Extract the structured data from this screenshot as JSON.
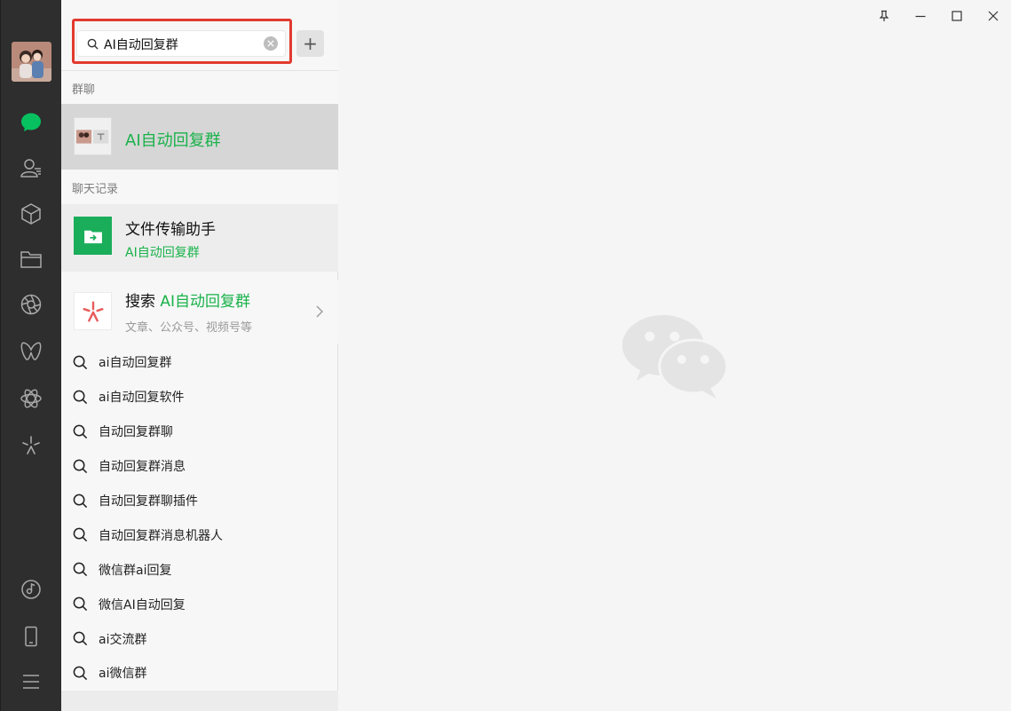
{
  "window": {
    "pin_icon": "pin-icon",
    "minimize_icon": "minimize-icon",
    "maximize_icon": "maximize-icon",
    "close_icon": "close-icon"
  },
  "navbar": {
    "avatar": "user-avatar",
    "items": [
      {
        "name": "chat",
        "icon": "chat-bubble-icon",
        "active": true
      },
      {
        "name": "contacts",
        "icon": "contacts-icon",
        "active": false
      },
      {
        "name": "favorites",
        "icon": "cube-icon",
        "active": false
      },
      {
        "name": "files",
        "icon": "folder-icon",
        "active": false
      },
      {
        "name": "moments",
        "icon": "aperture-icon",
        "active": false
      },
      {
        "name": "channels",
        "icon": "butterfly-icon",
        "active": false
      },
      {
        "name": "search",
        "icon": "atom-icon",
        "active": false
      },
      {
        "name": "mini-programs",
        "icon": "sparkle-icon",
        "active": false
      }
    ],
    "bottom_items": [
      {
        "name": "music",
        "icon": "music-disc-icon"
      },
      {
        "name": "phone",
        "icon": "phone-icon"
      },
      {
        "name": "menu",
        "icon": "hamburger-menu-icon"
      }
    ],
    "accent_color": "#07c160"
  },
  "search": {
    "query": "AI自动回复群",
    "add_label": "+"
  },
  "sections": {
    "groups_header": "群聊",
    "history_header": "聊天记录"
  },
  "group_result": {
    "name": "AI自动回复群"
  },
  "chat_result": {
    "name": "文件传输助手",
    "match": "AI自动回复群"
  },
  "web_search": {
    "prefix": "搜索 ",
    "keyword": "AI自动回复群",
    "sub": "文章、公众号、视频号等"
  },
  "suggestions": [
    "ai自动回复群",
    "ai自动回复软件",
    "自动回复群聊",
    "自动回复群消息",
    "自动回复群聊插件",
    "自动回复群消息机器人",
    "微信群ai回复",
    "微信AI自动回复",
    "ai交流群",
    "ai微信群"
  ],
  "colors": {
    "highlight": "#19b24a",
    "red_box": "#e23a2f"
  }
}
